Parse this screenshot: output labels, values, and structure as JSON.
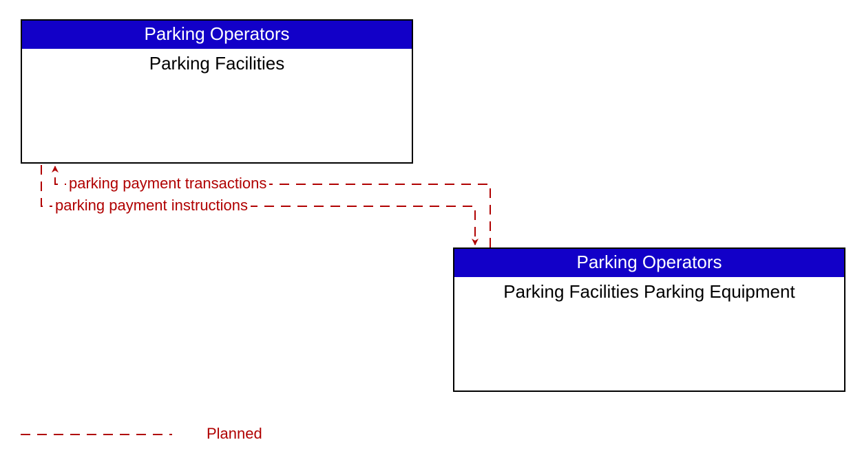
{
  "boxes": {
    "top": {
      "header": "Parking Operators",
      "title": "Parking Facilities"
    },
    "bottom": {
      "header": "Parking Operators",
      "title": "Parking Facilities Parking Equipment"
    }
  },
  "flows": {
    "to_top": "parking payment transactions",
    "to_bottom": "parking payment instructions"
  },
  "legend": {
    "planned": "Planned"
  },
  "colors": {
    "header_bg": "#1200c8",
    "line": "#b00000"
  }
}
